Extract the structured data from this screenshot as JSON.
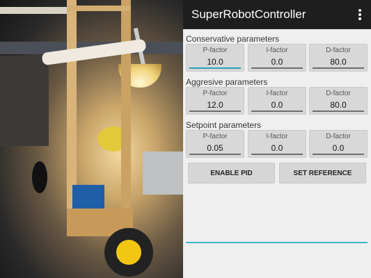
{
  "app": {
    "title": "SuperRobotController"
  },
  "sections": [
    {
      "title": "Conservative parameters",
      "fields": [
        {
          "label": "P-factor",
          "value": "10.0"
        },
        {
          "label": "I-factor",
          "value": "0.0"
        },
        {
          "label": "D-factor",
          "value": "80.0"
        }
      ]
    },
    {
      "title": "Aggresive parameters",
      "fields": [
        {
          "label": "P-factor",
          "value": "12.0"
        },
        {
          "label": "I-factor",
          "value": "0.0"
        },
        {
          "label": "D-factor",
          "value": "80.0"
        }
      ]
    },
    {
      "title": "Setpoint parameters",
      "fields": [
        {
          "label": "P-factor",
          "value": "0.05"
        },
        {
          "label": "I-factor",
          "value": "0.0"
        },
        {
          "label": "D-factor",
          "value": "0.0"
        }
      ]
    }
  ],
  "buttons": {
    "enable_pid": "ENABLE PID",
    "set_reference": "SET REFERENCE"
  },
  "colors": {
    "accent": "#27a2b8",
    "actionbar": "#1e1e1e"
  }
}
